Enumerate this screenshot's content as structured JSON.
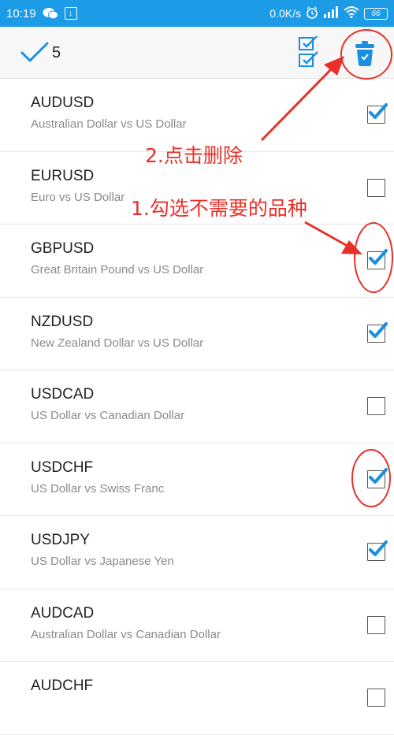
{
  "status_bar": {
    "time": "10:19",
    "network_speed": "0.0K/s",
    "battery": "66",
    "icons": [
      "wechat-icon",
      "download-icon",
      "alarm-icon",
      "signal-icon",
      "wifi-icon",
      "battery-icon"
    ]
  },
  "toolbar": {
    "selected_count": "5",
    "icons": [
      "checkmark-icon",
      "select-all-icon",
      "trash-icon"
    ]
  },
  "symbols": [
    {
      "symbol": "AUDUSD",
      "description": "Australian Dollar vs US Dollar",
      "checked": true
    },
    {
      "symbol": "EURUSD",
      "description": "Euro vs US Dollar",
      "checked": false
    },
    {
      "symbol": "GBPUSD",
      "description": "Great Britain Pound vs US Dollar",
      "checked": true
    },
    {
      "symbol": "NZDUSD",
      "description": "New Zealand Dollar vs US Dollar",
      "checked": true
    },
    {
      "symbol": "USDCAD",
      "description": "US Dollar vs Canadian Dollar",
      "checked": false
    },
    {
      "symbol": "USDCHF",
      "description": "US Dollar vs Swiss Franc",
      "checked": true
    },
    {
      "symbol": "USDJPY",
      "description": "US Dollar vs Japanese Yen",
      "checked": true
    },
    {
      "symbol": "AUDCAD",
      "description": "Australian Dollar vs Canadian Dollar",
      "checked": false
    },
    {
      "symbol": "AUDCHF",
      "description": "",
      "checked": false
    }
  ],
  "annotations": {
    "step2": "2.点击删除",
    "step1": "1.勾选不需要的品种"
  },
  "colors": {
    "status_bar": "#1c9be6",
    "accent_blue": "#1a8fe0",
    "annotation_red": "#e8302a"
  }
}
